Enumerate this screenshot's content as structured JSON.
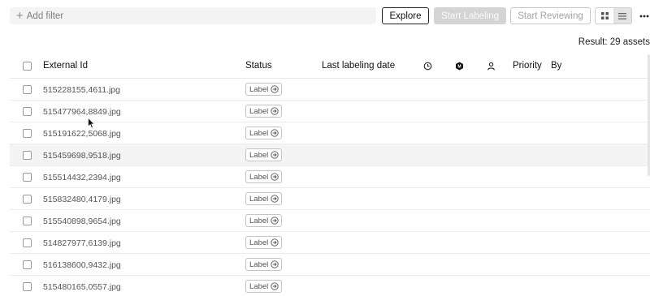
{
  "toolbar": {
    "filter_placeholder": "Add filter",
    "explore_label": "Explore",
    "start_labeling_label": "Start Labeling",
    "start_reviewing_label": "Start Reviewing",
    "view_modes": [
      "grid-view-icon",
      "list-view-icon"
    ],
    "active_view": "list"
  },
  "result_text": "Result: 29 assets",
  "table": {
    "columns": {
      "external_id": "External Id",
      "status": "Status",
      "last_labeling_date": "Last labeling date",
      "time_icon": "clock-icon",
      "model_icon": "model-hexagon-icon",
      "user_icon": "person-icon",
      "priority": "Priority",
      "by": "By"
    },
    "rows": [
      {
        "external_id": "515228155,4611.jpg",
        "status": "Label"
      },
      {
        "external_id": "515477964,8849.jpg",
        "status": "Label"
      },
      {
        "external_id": "515191622,5068.jpg",
        "status": "Label"
      },
      {
        "external_id": "515459698,9518.jpg",
        "status": "Label"
      },
      {
        "external_id": "515514432,2394.jpg",
        "status": "Label"
      },
      {
        "external_id": "515832480,4179.jpg",
        "status": "Label"
      },
      {
        "external_id": "515540898,9654.jpg",
        "status": "Label"
      },
      {
        "external_id": "514827977,6139.jpg",
        "status": "Label"
      },
      {
        "external_id": "516138600,9432.jpg",
        "status": "Label"
      },
      {
        "external_id": "515480165,0557.jpg",
        "status": "Label"
      }
    ]
  },
  "colors": {
    "primary_disabled": "#d4d4d4",
    "row_hover": "#f4f4f5",
    "border": "#ececec"
  }
}
